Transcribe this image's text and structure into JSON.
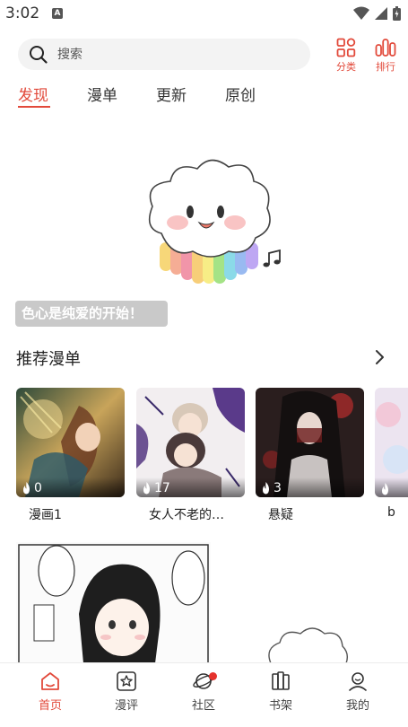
{
  "status_bar": {
    "time": "3:02",
    "notification_letter": "A"
  },
  "header": {
    "search_placeholder": "搜索",
    "category_label": "分类",
    "ranking_label": "排行"
  },
  "tabs": [
    {
      "label": "发现",
      "active": true
    },
    {
      "label": "漫单",
      "active": false
    },
    {
      "label": "更新",
      "active": false
    },
    {
      "label": "原创",
      "active": false
    }
  ],
  "banner": {
    "caption": "色心是纯爱的开始！"
  },
  "recommended": {
    "title": "推荐漫单",
    "cards": [
      {
        "title": "漫画1",
        "heat": "0"
      },
      {
        "title": "女人不老的…",
        "heat": "17"
      },
      {
        "title": "悬疑",
        "heat": "3"
      },
      {
        "title": "b",
        "heat": ""
      }
    ]
  },
  "bottom_nav": [
    {
      "label": "首页",
      "icon": "home-icon",
      "active": true
    },
    {
      "label": "漫评",
      "icon": "star-icon",
      "active": false
    },
    {
      "label": "社区",
      "icon": "planet-icon",
      "active": false
    },
    {
      "label": "书架",
      "icon": "bookshelf-icon",
      "active": false
    },
    {
      "label": "我的",
      "icon": "profile-icon",
      "active": false
    }
  ],
  "colors": {
    "accent": "#e24a3b",
    "badge": "#e5322d"
  }
}
